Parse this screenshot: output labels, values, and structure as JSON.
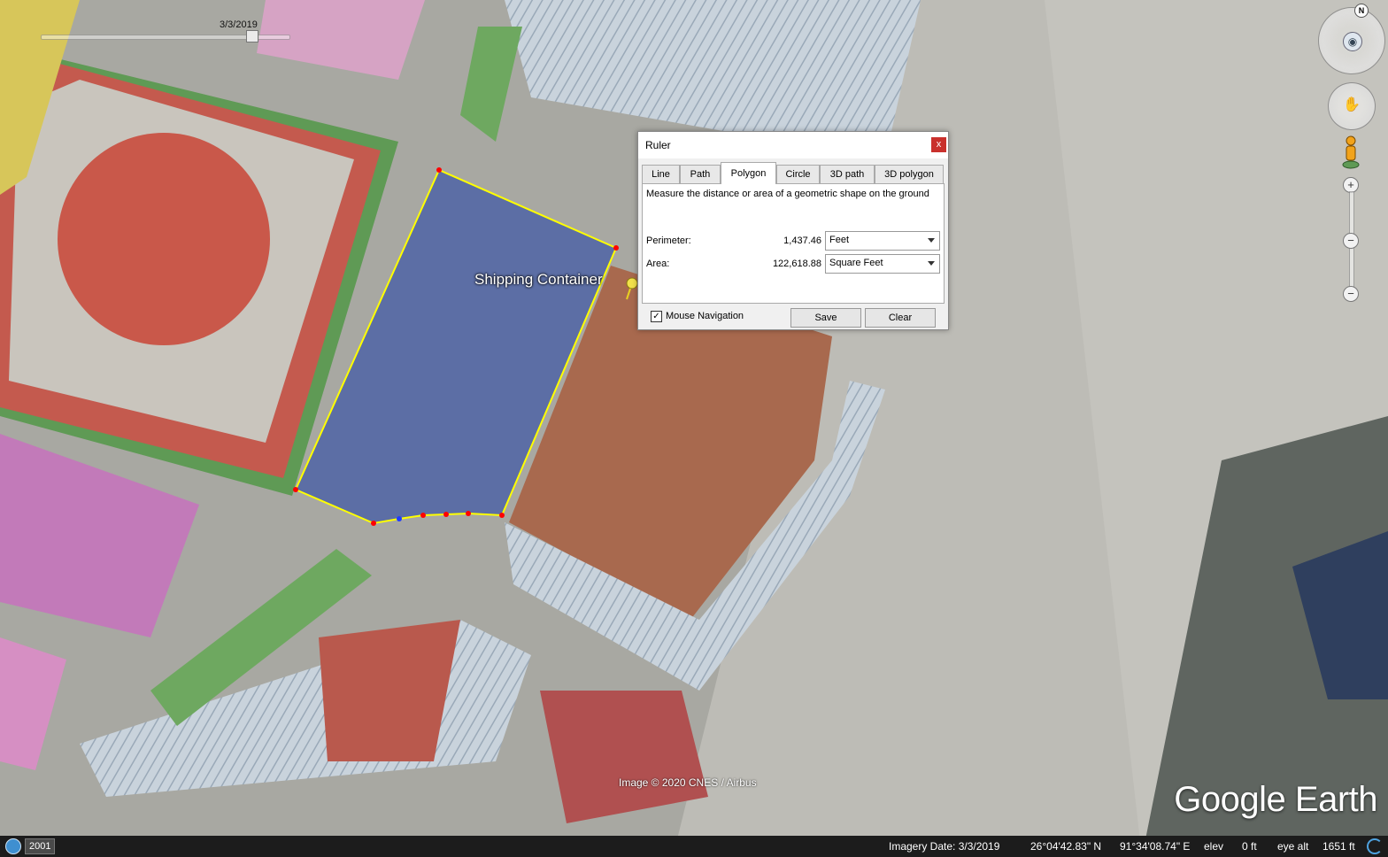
{
  "map": {
    "placemark_label": "Shipping Container",
    "image_credit": "Image © 2020 CNES / Airbus",
    "brand": "Google Earth",
    "timeline_date": "3/3/2019",
    "compass_letter": "N"
  },
  "ruler": {
    "title": "Ruler",
    "close_label": "x",
    "tabs": [
      {
        "label": "Line"
      },
      {
        "label": "Path"
      },
      {
        "label": "Polygon"
      },
      {
        "label": "Circle"
      },
      {
        "label": "3D path"
      },
      {
        "label": "3D polygon"
      }
    ],
    "active_tab": "Polygon",
    "description": "Measure the distance or area of a geometric shape on the ground",
    "perimeter_label": "Perimeter:",
    "perimeter_value": "1,437.46",
    "perimeter_unit": "Feet",
    "area_label": "Area:",
    "area_value": "122,618.88",
    "area_unit": "Square Feet",
    "mouse_nav_label": "Mouse Navigation",
    "mouse_nav_checked": true,
    "check_mark": "✓",
    "save_label": "Save",
    "clear_label": "Clear"
  },
  "zoom": {
    "plus": "+",
    "minus": "−"
  },
  "status": {
    "year": "2001",
    "imagery_date": "Imagery Date: 3/3/2019",
    "latitude": "26°04'42.83\" N",
    "longitude": "91°34'08.74\" E",
    "elev_label": "elev",
    "elev_value": "0 ft",
    "eye_alt_label": "eye alt",
    "eye_alt_value": "1651 ft"
  },
  "colors": {
    "polygon_line": "#ffff00",
    "vertex": "#ff0000",
    "close_button": "#c9302c"
  }
}
